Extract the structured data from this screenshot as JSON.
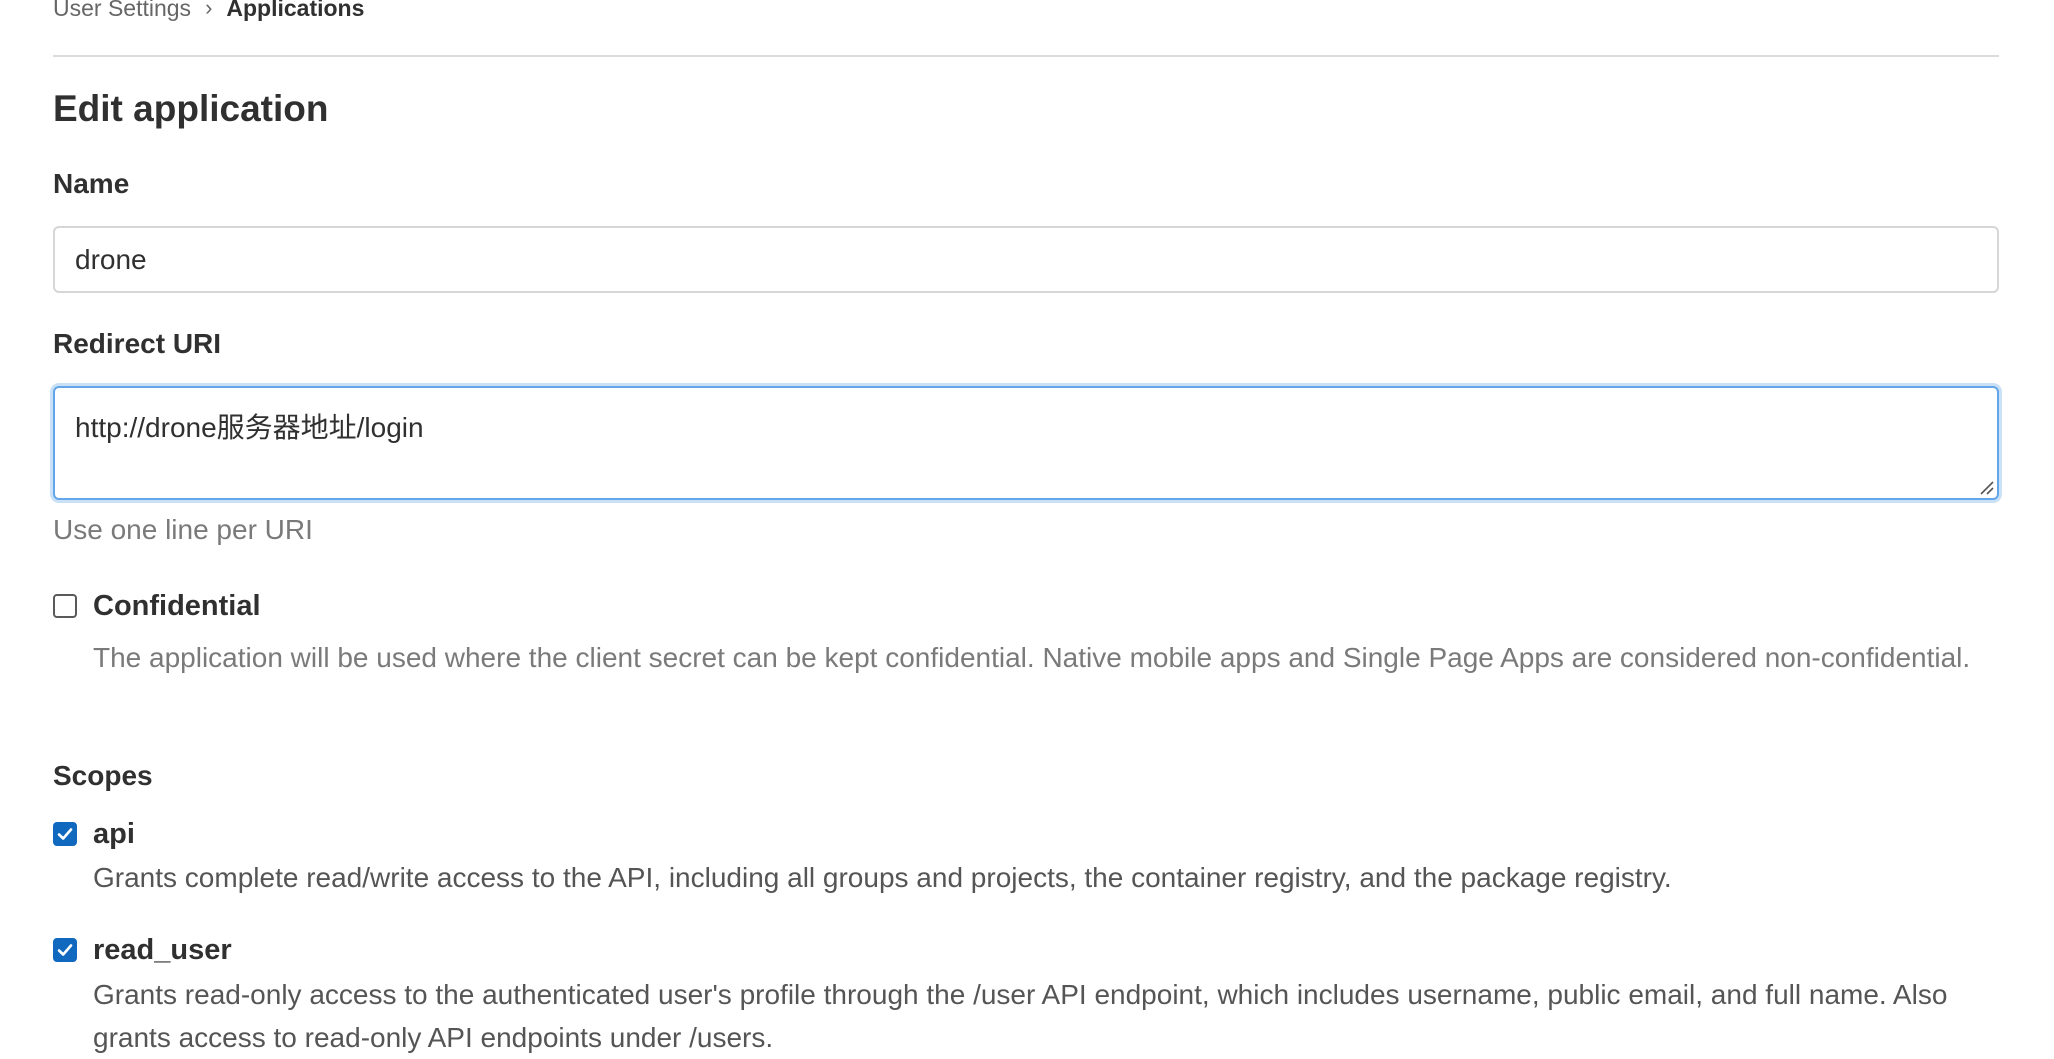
{
  "breadcrumb": {
    "parent": "User Settings",
    "separator": "›",
    "current": "Applications"
  },
  "heading": "Edit application",
  "name_field": {
    "label": "Name",
    "value": "drone"
  },
  "redirect_field": {
    "label": "Redirect URI",
    "value": "http://drone服务器地址/login",
    "help": "Use one line per URI"
  },
  "confidential": {
    "label": "Confidential",
    "checked": false,
    "description": "The application will be used where the client secret can be kept confidential. Native mobile apps and Single Page Apps are considered non-confidential."
  },
  "scopes": {
    "label": "Scopes",
    "items": [
      {
        "name": "api",
        "checked": true,
        "description": "Grants complete read/write access to the API, including all groups and projects, the container registry, and the package registry."
      },
      {
        "name": "read_user",
        "checked": true,
        "description": "Grants read-only access to the authenticated user's profile through the /user API endpoint, which includes username, public email, and full name. Also grants access to read-only API endpoints under /users."
      }
    ]
  },
  "colors": {
    "accent": "#1068bf",
    "focus_border": "#63a6e9",
    "muted_text": "#7a7a7a"
  }
}
